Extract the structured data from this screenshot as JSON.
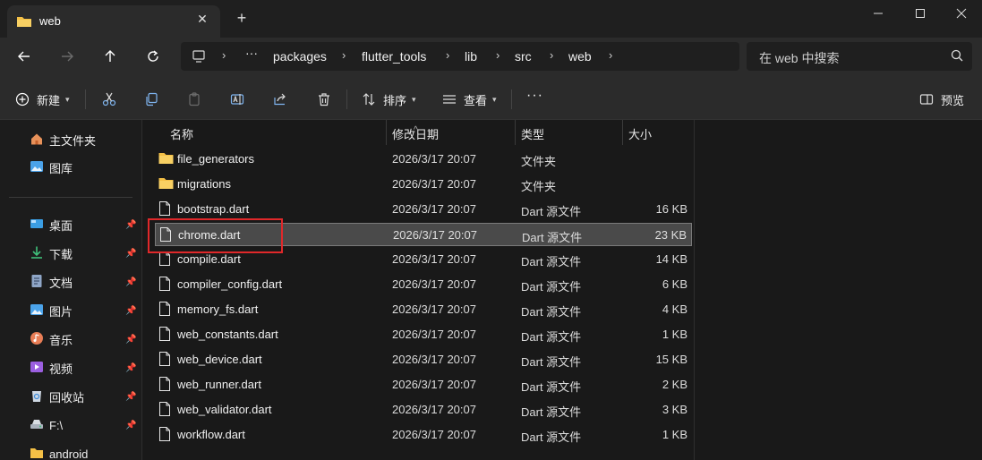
{
  "window": {
    "tab_title": "web",
    "new_tab": "+",
    "tab_close": "✕"
  },
  "nav": {
    "back": "back",
    "forward": "forward",
    "up": "up",
    "refresh": "refresh"
  },
  "address": {
    "ellipsis": "···",
    "crumbs": [
      "packages",
      "flutter_tools",
      "lib",
      "src",
      "web"
    ]
  },
  "search": {
    "placeholder": "在 web 中搜索"
  },
  "toolbar": {
    "new_label": "新建",
    "sort_label": "排序",
    "view_label": "查看",
    "more": "···",
    "preview_label": "预览"
  },
  "sidebar": {
    "items": [
      {
        "label": "主文件夹",
        "icon": "home-icon",
        "pinned": false
      },
      {
        "label": "图库",
        "icon": "gallery-icon",
        "pinned": false
      },
      {
        "label": "桌面",
        "icon": "desktop-icon",
        "pinned": true
      },
      {
        "label": "下载",
        "icon": "download-icon",
        "pinned": true
      },
      {
        "label": "文档",
        "icon": "documents-icon",
        "pinned": true
      },
      {
        "label": "图片",
        "icon": "pictures-icon",
        "pinned": true
      },
      {
        "label": "音乐",
        "icon": "music-icon",
        "pinned": true
      },
      {
        "label": "视频",
        "icon": "videos-icon",
        "pinned": true
      },
      {
        "label": "回收站",
        "icon": "recycle-bin-icon",
        "pinned": true
      },
      {
        "label": "F:\\",
        "icon": "drive-icon",
        "pinned": true
      },
      {
        "label": "android",
        "icon": "folder-icon",
        "pinned": false
      }
    ]
  },
  "columns": {
    "name": "名称",
    "date": "修改日期",
    "type": "类型",
    "size": "大小"
  },
  "files": [
    {
      "name": "file_generators",
      "date": "2026/3/17 20:07",
      "type": "文件夹",
      "size": "",
      "kind": "folder"
    },
    {
      "name": "migrations",
      "date": "2026/3/17 20:07",
      "type": "文件夹",
      "size": "",
      "kind": "folder"
    },
    {
      "name": "bootstrap.dart",
      "date": "2026/3/17 20:07",
      "type": "Dart 源文件",
      "size": "16 KB",
      "kind": "file"
    },
    {
      "name": "chrome.dart",
      "date": "2026/3/17 20:07",
      "type": "Dart 源文件",
      "size": "23 KB",
      "kind": "file",
      "selected": true
    },
    {
      "name": "compile.dart",
      "date": "2026/3/17 20:07",
      "type": "Dart 源文件",
      "size": "14 KB",
      "kind": "file"
    },
    {
      "name": "compiler_config.dart",
      "date": "2026/3/17 20:07",
      "type": "Dart 源文件",
      "size": "6 KB",
      "kind": "file"
    },
    {
      "name": "memory_fs.dart",
      "date": "2026/3/17 20:07",
      "type": "Dart 源文件",
      "size": "4 KB",
      "kind": "file"
    },
    {
      "name": "web_constants.dart",
      "date": "2026/3/17 20:07",
      "type": "Dart 源文件",
      "size": "1 KB",
      "kind": "file"
    },
    {
      "name": "web_device.dart",
      "date": "2026/3/17 20:07",
      "type": "Dart 源文件",
      "size": "15 KB",
      "kind": "file"
    },
    {
      "name": "web_runner.dart",
      "date": "2026/3/17 20:07",
      "type": "Dart 源文件",
      "size": "2 KB",
      "kind": "file"
    },
    {
      "name": "web_validator.dart",
      "date": "2026/3/17 20:07",
      "type": "Dart 源文件",
      "size": "3 KB",
      "kind": "file"
    },
    {
      "name": "workflow.dart",
      "date": "2026/3/17 20:07",
      "type": "Dart 源文件",
      "size": "1 KB",
      "kind": "file"
    }
  ],
  "colors": {
    "folder": "#f4c046",
    "highlight": "#e0282a",
    "selection": "#4a4a4a"
  }
}
